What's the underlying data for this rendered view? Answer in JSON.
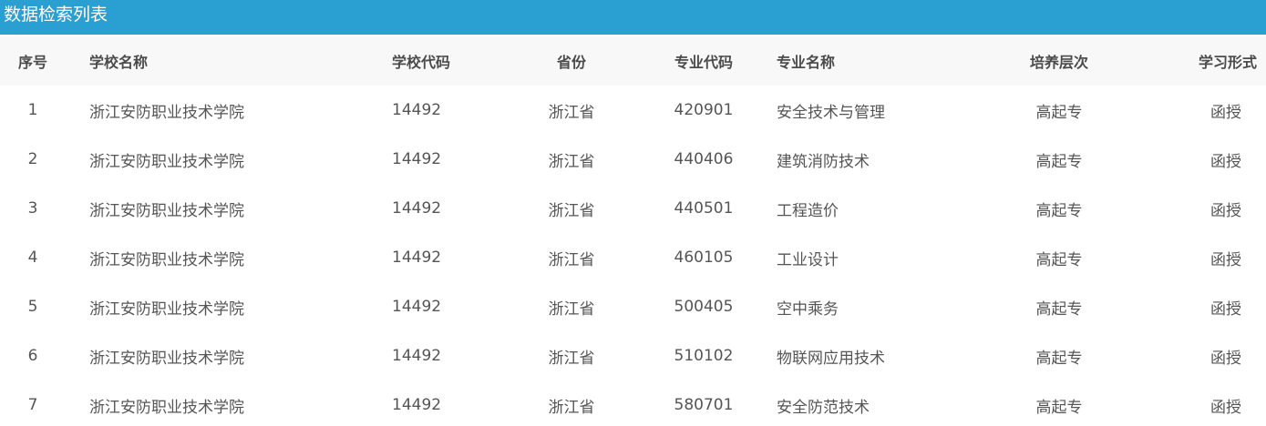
{
  "panel": {
    "title": "数据检索列表"
  },
  "columns": {
    "index": "序号",
    "school_name": "学校名称",
    "school_code": "学校代码",
    "province": "省份",
    "major_code": "专业代码",
    "major_name": "专业名称",
    "level": "培养层次",
    "study_form": "学习形式"
  },
  "rows": [
    {
      "index": "1",
      "school_name": "浙江安防职业技术学院",
      "school_code": "14492",
      "province": "浙江省",
      "major_code": "420901",
      "major_name": "安全技术与管理",
      "level": "高起专",
      "study_form": "函授"
    },
    {
      "index": "2",
      "school_name": "浙江安防职业技术学院",
      "school_code": "14492",
      "province": "浙江省",
      "major_code": "440406",
      "major_name": "建筑消防技术",
      "level": "高起专",
      "study_form": "函授"
    },
    {
      "index": "3",
      "school_name": "浙江安防职业技术学院",
      "school_code": "14492",
      "province": "浙江省",
      "major_code": "440501",
      "major_name": "工程造价",
      "level": "高起专",
      "study_form": "函授"
    },
    {
      "index": "4",
      "school_name": "浙江安防职业技术学院",
      "school_code": "14492",
      "province": "浙江省",
      "major_code": "460105",
      "major_name": "工业设计",
      "level": "高起专",
      "study_form": "函授"
    },
    {
      "index": "5",
      "school_name": "浙江安防职业技术学院",
      "school_code": "14492",
      "province": "浙江省",
      "major_code": "500405",
      "major_name": "空中乘务",
      "level": "高起专",
      "study_form": "函授"
    },
    {
      "index": "6",
      "school_name": "浙江安防职业技术学院",
      "school_code": "14492",
      "province": "浙江省",
      "major_code": "510102",
      "major_name": "物联网应用技术",
      "level": "高起专",
      "study_form": "函授"
    },
    {
      "index": "7",
      "school_name": "浙江安防职业技术学院",
      "school_code": "14492",
      "province": "浙江省",
      "major_code": "580701",
      "major_name": "安全防范技术",
      "level": "高起专",
      "study_form": "函授"
    }
  ],
  "colors": {
    "header_bar": "#299fd2",
    "header_text": "#ffffff",
    "table_head_bg": "#f8f8f8",
    "table_head_text": "#4b4b4b",
    "cell_text": "#555555"
  }
}
